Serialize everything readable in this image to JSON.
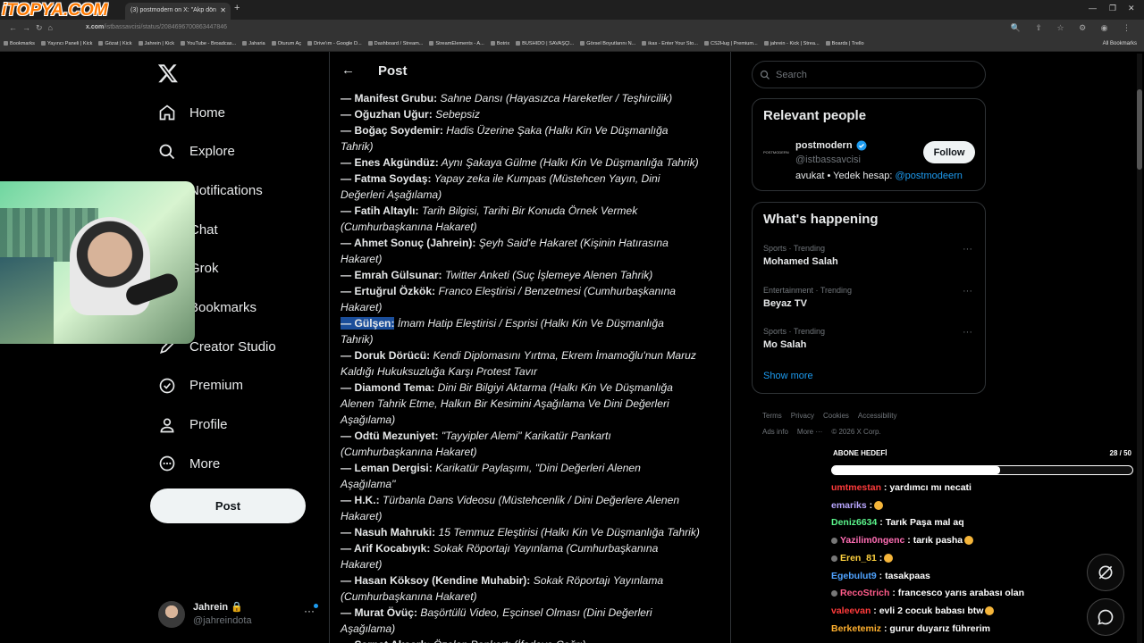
{
  "browser": {
    "logo": "iTOPYA.COM",
    "tab_title": "(3) postmodern on X: \"Akp dön",
    "url_host": "x.com",
    "url_path": "/istbassavcisi/status/2084696700863447846",
    "all_bookmarks": "All Bookmarks",
    "bookmarks": [
      "Bookmarks",
      "Yayıncı Paneli | Kick",
      "Gözat | Kick",
      "Jahrein | Kick",
      "YouTube - Broadcas...",
      "Jaharia",
      "Oturum Aç",
      "Drive'ım - Google D...",
      "Dashboard / Stream...",
      "StreamElements - A...",
      "Botrix",
      "BUSHIDO | SAVAŞÇI...",
      "Görsel Boyutlarını N...",
      "ikas - Enter Your Sto...",
      "CS2Hug | Premium...",
      "jahrein - Kick | Strea...",
      "Boards | Trello"
    ]
  },
  "nav": {
    "items": [
      {
        "label": "Home",
        "icon": "home-icon"
      },
      {
        "label": "Explore",
        "icon": "search-icon"
      },
      {
        "label": "Notifications",
        "icon": "bell-icon"
      },
      {
        "label": "Chat",
        "icon": "chat-icon"
      },
      {
        "label": "Grok",
        "icon": "grok-icon"
      },
      {
        "label": "Bookmarks",
        "icon": "bookmark-icon"
      },
      {
        "label": "Creator Studio",
        "icon": "creator-studio-icon"
      },
      {
        "label": "Premium",
        "icon": "premium-icon"
      },
      {
        "label": "Profile",
        "icon": "profile-icon"
      },
      {
        "label": "More",
        "icon": "more-icon"
      }
    ],
    "post_button": "Post",
    "account": {
      "name": "Jahrein",
      "handle": "@jahreindota",
      "more": "···"
    }
  },
  "center": {
    "title": "Post",
    "lines": [
      {
        "bold": "— Manifest Grubu:",
        "italic": " Sahne Dansı (Hayasızca Hareketler / Teşhircilik)"
      },
      {
        "bold": "— Oğuzhan Uğur:",
        "italic": " Sebepsiz"
      },
      {
        "bold": "— Boğaç Soydemir:",
        "italic": " Hadis Üzerine Şaka (Halkı Kin Ve Düşmanlığa"
      },
      {
        "bold": "",
        "italic": "Tahrik)"
      },
      {
        "bold": "— Enes Akgündüz:",
        "italic": " Aynı Şakaya Gülme (Halkı Kin Ve Düşmanlığa Tahrik)"
      },
      {
        "bold": "— Fatma Soydaş:",
        "italic": " Yapay zeka ile Kumpas (Müstehcen Yayın, Dini"
      },
      {
        "bold": "",
        "italic": "Değerleri Aşağılama)"
      },
      {
        "bold": "— Fatih Altaylı:",
        "italic": " Tarih Bilgisi, Tarihi Bir Konuda Örnek Vermek"
      },
      {
        "bold": "",
        "italic": "(Cumhurbaşkanına Hakaret)"
      },
      {
        "bold": "— Ahmet Sonuç (Jahrein):",
        "italic": " Şeyh Said'e Hakaret (Kişinin Hatırasına"
      },
      {
        "bold": "",
        "italic": "Hakaret)"
      },
      {
        "bold": "— Emrah Gülsunar:",
        "italic": " Twitter Anketi (Suç İşlemeye Alenen Tahrik)"
      },
      {
        "bold": "— Ertuğrul Özkök:",
        "italic": " Franco Eleştirisi / Benzetmesi (Cumhurbaşkanına"
      },
      {
        "bold": "",
        "italic": "Hakaret)"
      },
      {
        "bold": "— Gülşen:",
        "italic": " İmam Hatip Eleştirisi / Esprisi (Halkı Kin Ve Düşmanlığa",
        "highlight": true
      },
      {
        "bold": "",
        "italic": "Tahrik)"
      },
      {
        "bold": "— Doruk Dörücü:",
        "italic": " Kendi Diplomasını Yırtma, Ekrem İmamoğlu'nun Maruz"
      },
      {
        "bold": "",
        "italic": "Kaldığı Hukuksuzluğa Karşı Protest Tavır"
      },
      {
        "bold": "— Diamond Tema:",
        "italic": " Dini Bir Bilgiyi Aktarma (Halkı Kin Ve Düşmanlığa"
      },
      {
        "bold": "",
        "italic": "Alenen Tahrik Etme, Halkın Bir Kesimini Aşağılama Ve Dini Değerleri"
      },
      {
        "bold": "",
        "italic": "Aşağılama)"
      },
      {
        "bold": "— Odtü Mezuniyet:",
        "italic": " \"Tayyipler Alemi\" Karikatür Pankartı"
      },
      {
        "bold": "",
        "italic": "(Cumhurbaşkanına Hakaret)"
      },
      {
        "bold": "— Leman Dergisi:",
        "italic": " Karikatür Paylaşımı, \"Dini Değerleri Alenen"
      },
      {
        "bold": "",
        "italic": "Aşağılama\""
      },
      {
        "bold": "— H.K.:",
        "italic": " Türbanla Dans Videosu (Müstehcenlik / Dini Değerlere Alenen"
      },
      {
        "bold": "",
        "italic": "Hakaret)"
      },
      {
        "bold": "— Nasuh Mahruki:",
        "italic": " 15 Temmuz Eleştirisi (Halkı Kin Ve Düşmanlığa Tahrik)"
      },
      {
        "bold": "— Arif Kocabıyık:",
        "italic": " Sokak Röportajı Yayınlama (Cumhurbaşkanına"
      },
      {
        "bold": "",
        "italic": "Hakaret)"
      },
      {
        "bold": "— Hasan Köksoy (Kendine Muhabir):",
        "italic": " Sokak Röportajı Yayınlama"
      },
      {
        "bold": "",
        "italic": "(Cumhurbaşkanına Hakaret)"
      },
      {
        "bold": "— Murat Övüç:",
        "italic": " Başörtülü Video, Eşcinsel Olması (Dini Değerleri"
      },
      {
        "bold": "",
        "italic": "Aşağılama)"
      },
      {
        "bold": "— Sarnat Akaarlı:",
        "italic": " Özalan Pankartı (İfadeye Çağrı)"
      }
    ]
  },
  "right": {
    "search_placeholder": "Search",
    "relevant": {
      "title": "Relevant people",
      "name": "postmodern",
      "handle": "@istbassavcisi",
      "bio_text": "avukat • Yedek hesap: ",
      "bio_link": "@postmodeern",
      "follow": "Follow",
      "avatar_text": "POSTMODERN"
    },
    "happening": {
      "title": "What's happening",
      "trends": [
        {
          "category": "Sports · Trending",
          "name": "Mohamed Salah"
        },
        {
          "category": "Entertainment · Trending",
          "name": "Beyaz TV"
        },
        {
          "category": "Sports · Trending",
          "name": "Mo Salah"
        }
      ],
      "show_more": "Show more"
    },
    "footer": [
      "Terms",
      "Privacy",
      "Cookies",
      "Accessibility",
      "Ads info",
      "More ···",
      "© 2026 X Corp."
    ]
  },
  "overlay": {
    "goal_label": "ABONE HEDEFİ",
    "goal_count": "28 / 50",
    "goal_progress": 0.56,
    "chat": [
      {
        "user": "umtmestan",
        "color": "#ff3b3b",
        "text": " : yardımcı mı necati",
        "badge": false,
        "emote": false
      },
      {
        "user": "emariks",
        "color": "#b9a7ff",
        "text": " :",
        "badge": false,
        "emote": true
      },
      {
        "user": "Deniz6634",
        "color": "#5bf58b",
        "text": " : Tarık Paşa mal aq",
        "badge": false,
        "emote": false
      },
      {
        "user": "Yazilim0ngenc",
        "color": "#ff6eb4",
        "text": " : tarık pasha",
        "badge": true,
        "emote": true
      },
      {
        "user": "Eren_81",
        "color": "#ffd23f",
        "text": " :",
        "badge": true,
        "emote": true
      },
      {
        "user": "Egebulut9",
        "color": "#4fa3ff",
        "text": " : tasakpaas",
        "badge": false,
        "emote": false
      },
      {
        "user": "RecoStrich",
        "color": "#ff5c8a",
        "text": " : francesco yarıs arabası olan",
        "badge": true,
        "emote": false
      },
      {
        "user": "valeevan",
        "color": "#ff3b3b",
        "text": " : evli 2 cocuk babası btw",
        "badge": false,
        "emote": true
      },
      {
        "user": "Berketemiz",
        "color": "#ffb02e",
        "text": " : gurur duyarız führerim",
        "badge": false,
        "emote": false
      }
    ]
  }
}
